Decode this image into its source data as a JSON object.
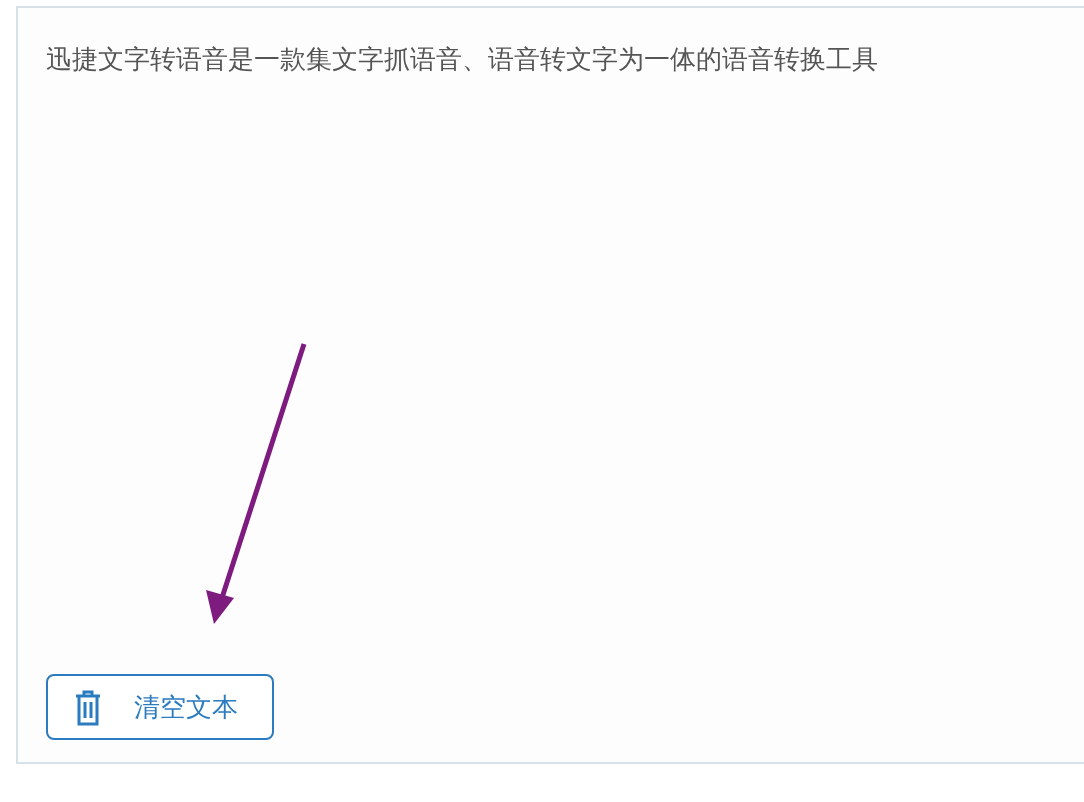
{
  "editor": {
    "text": "迅捷文字转语音是一款集文字抓语音、语音转文字为一体的语音转换工具"
  },
  "clear_button": {
    "label": "清空文本"
  }
}
